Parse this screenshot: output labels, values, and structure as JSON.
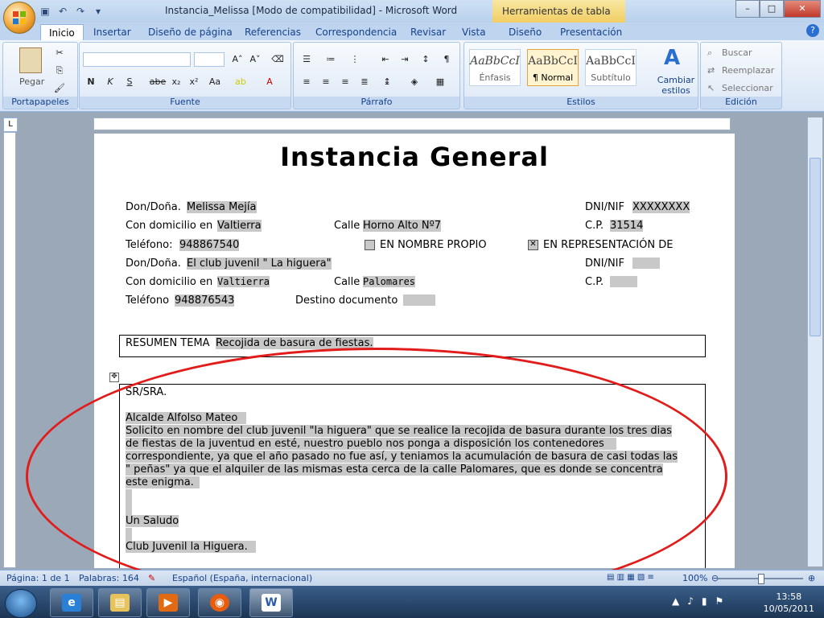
{
  "window": {
    "title": "Instancia_Melissa [Modo de compatibilidad] - Microsoft Word",
    "contextual_tab_group": "Herramientas de tabla",
    "minimize": "–",
    "maximize": "□",
    "close": "✕"
  },
  "ribbon_tabs": [
    "Inicio",
    "Insertar",
    "Diseño de página",
    "Referencias",
    "Correspondencia",
    "Revisar",
    "Vista",
    "Diseño",
    "Presentación"
  ],
  "ribbon": {
    "clipboard": {
      "paste": "Pegar",
      "label": "Portapapeles"
    },
    "font": {
      "label": "Fuente",
      "bold": "N",
      "italic": "K",
      "underline": "S",
      "strike": "abe",
      "subscript": "x₂",
      "superscript": "x²",
      "case": "Aa",
      "grow": "A˄",
      "shrink": "A˅",
      "color": "A"
    },
    "paragraph": {
      "label": "Párrafo",
      "show_marks": "¶"
    },
    "styles": {
      "label": "Estilos",
      "items": [
        {
          "preview": "AaBbCcI",
          "name": "Énfasis"
        },
        {
          "preview": "AaBbCcI",
          "name": "¶ Normal"
        },
        {
          "preview": "AaBbCcI",
          "name": "Subtítulo"
        }
      ],
      "change": "Cambiar estilos"
    },
    "editing": {
      "label": "Edición",
      "find": "Buscar",
      "replace": "Reemplazar",
      "select": "Seleccionar"
    }
  },
  "document": {
    "heading": "Instancia General",
    "row1": {
      "label": "Don/Doña.",
      "name": "Melissa Mejía",
      "dni_label": "DNI/NIF",
      "dni": "XXXXXXXX"
    },
    "row2": {
      "label": "Con domicilio  en",
      "city": "Valtierra",
      "street_label": "Calle",
      "street": "Horno Alto Nº7",
      "cp_label": "C.P.",
      "cp": "31514"
    },
    "row3": {
      "label": "Teléfono:",
      "phone": "948867540",
      "own_name": "EN NOMBRE PROPIO",
      "representation": "EN REPRESENTACIÓN  DE"
    },
    "row4": {
      "label": "Don/Doña.",
      "name": "El club juvenil \" La higuera\"",
      "dni_label": "DNI/NIF"
    },
    "row5": {
      "label": "Con domicilio  en",
      "city": "Valtierra",
      "street_label": "Calle",
      "street": "Palomares",
      "cp_label": "C.P."
    },
    "row6": {
      "label": "Teléfono",
      "phone": "948876543",
      "dest_label": "Destino documento"
    },
    "summary": {
      "label": "RESUMEN TEMA",
      "value": "Recojida de basura de fiestas."
    },
    "body": {
      "salutation": "SR/SRA.",
      "addressee": "Alcalde Alfolso  Mateo",
      "paragraph_lines": [
        "Solicito en nombre del club juvenil \"la higuera\" que se realice la recojida de basura durante los tres dias",
        "de fiestas de la juventud en esté, nuestro pueblo nos ponga a disposición  los contenedores",
        "correspondiente, ya que el año pasado no fue así, y teniamos la acumulación  de basura de casi todas las",
        "\" peñas\" ya que el alquiler  de las mismas esta cerca de la calle Palomares, que es donde se concentra",
        "este enigma."
      ],
      "closing": "Un Saludo",
      "signature": "Club Juvenil  la Higuera."
    }
  },
  "status_bar": {
    "page": "Página: 1 de 1",
    "words": "Palabras: 164",
    "language": "Español (España, internacional)",
    "zoom": "100%",
    "zoom_fraction": 0.5
  },
  "taskbar": {
    "time": "13:58",
    "date": "10/05/2011"
  },
  "annotation_color": "#e21b1b"
}
